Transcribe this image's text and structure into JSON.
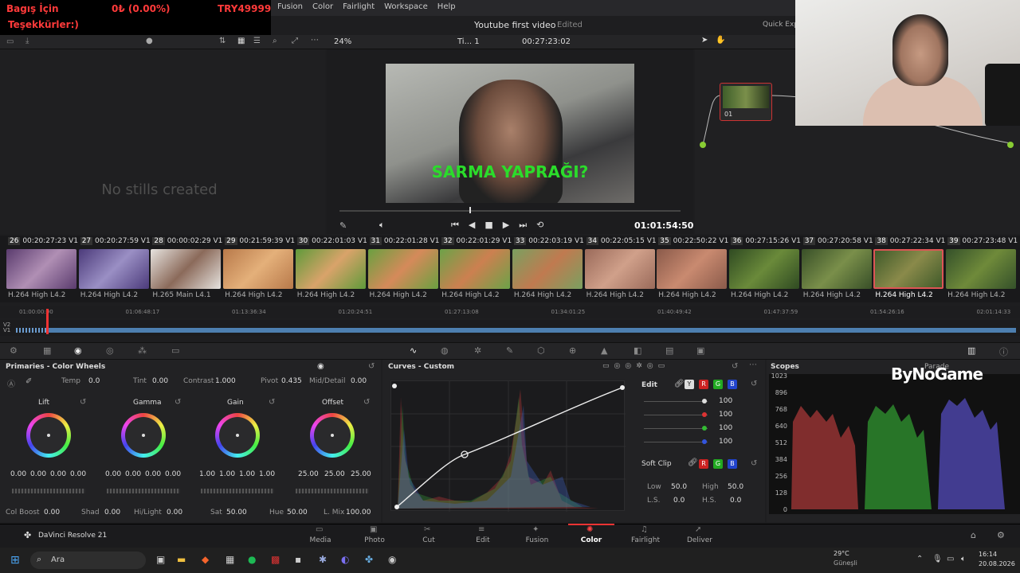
{
  "menu": [
    "Fusion",
    "Color",
    "Fairlight",
    "Workspace",
    "Help"
  ],
  "donation": {
    "line1": "Bagış İçin",
    "amount": "0₺ (0.00%)",
    "goal": "TRY49999",
    "line2": "Teşekkürler:)"
  },
  "project": {
    "title": "Youtube first video",
    "status": "Edited",
    "quick_export": "Quick Export"
  },
  "toolbar": {
    "zoom": "24%",
    "timeline": "Ti... 1",
    "timecode": "00:27:23:02"
  },
  "gallery": {
    "empty": "No stills created"
  },
  "viewer": {
    "subtitle": "SARMA YAPRAĞI?",
    "time": "01:01:54:50"
  },
  "node": {
    "label": "01"
  },
  "clips": [
    {
      "num": "26",
      "tc": "00:20:27:23",
      "track": "V1",
      "codec": "H.264 High L4.2",
      "c1": "#5a3b6e",
      "c2": "#b08fb4"
    },
    {
      "num": "27",
      "tc": "00:20:27:59",
      "track": "V1",
      "codec": "H.264 High L4.2",
      "c1": "#4b3a7a",
      "c2": "#9a8fc4"
    },
    {
      "num": "28",
      "tc": "00:00:02:29",
      "track": "V1",
      "codec": "H.265 Main L4.1",
      "c1": "#e6e3df",
      "c2": "#8b6a5a"
    },
    {
      "num": "29",
      "tc": "00:21:59:39",
      "track": "V1",
      "codec": "H.264 High L4.2",
      "c1": "#b8794a",
      "c2": "#e4b07a"
    },
    {
      "num": "30",
      "tc": "00:22:01:03",
      "track": "V1",
      "codec": "H.264 High L4.2",
      "c1": "#5f9a3a",
      "c2": "#d9a36a"
    },
    {
      "num": "31",
      "tc": "00:22:01:28",
      "track": "V1",
      "codec": "H.264 High L4.2",
      "c1": "#6aa040",
      "c2": "#d58a5a"
    },
    {
      "num": "32",
      "tc": "00:22:01:29",
      "track": "V1",
      "codec": "H.264 High L4.2",
      "c1": "#6ca248",
      "c2": "#cc8050"
    },
    {
      "num": "33",
      "tc": "00:22:03:19",
      "track": "V1",
      "codec": "H.264 High L4.2",
      "c1": "#7aa060",
      "c2": "#c07a50"
    },
    {
      "num": "34",
      "tc": "00:22:05:15",
      "track": "V1",
      "codec": "H.264 High L4.2",
      "c1": "#9a6a5a",
      "c2": "#d0a08a"
    },
    {
      "num": "35",
      "tc": "00:22:50:22",
      "track": "V1",
      "codec": "H.264 High L4.2",
      "c1": "#8a5a4a",
      "c2": "#c98a70"
    },
    {
      "num": "36",
      "tc": "00:27:15:26",
      "track": "V1",
      "codec": "H.264 High L4.2",
      "c1": "#2f4a22",
      "c2": "#6a8a3a"
    },
    {
      "num": "37",
      "tc": "00:27:20:58",
      "track": "V1",
      "codec": "H.264 High L4.2",
      "c1": "#384f28",
      "c2": "#7a8f4a"
    },
    {
      "num": "38",
      "tc": "00:27:22:34",
      "track": "V1",
      "codec": "H.264 High L4.2",
      "c1": "#3f5a2a",
      "c2": "#8a8a4a"
    },
    {
      "num": "39",
      "tc": "00:27:23:48",
      "track": "V1",
      "codec": "H.264 High L4.2",
      "c1": "#34502a",
      "c2": "#6f8a3a"
    }
  ],
  "ruler": [
    "01:00:00:00",
    "01:06:48:17",
    "01:13:36:34",
    "01:20:24:51",
    "01:27:13:08",
    "01:34:01:25",
    "01:40:49:42",
    "01:47:37:59",
    "01:54:26:16",
    "02:01:14:33"
  ],
  "tracks": {
    "v2": "V2",
    "v1": "V1"
  },
  "primaries": {
    "title": "Primaries - Color Wheels",
    "temp_label": "Temp",
    "temp": "0.0",
    "tint_label": "Tint",
    "tint": "0.00",
    "contrast_label": "Contrast",
    "contrast": "1.000",
    "pivot_label": "Pivot",
    "pivot": "0.435",
    "middetail_label": "Mid/Detail",
    "middetail": "0.00",
    "wheels": [
      {
        "name": "Lift",
        "vals": [
          "0.00",
          "0.00",
          "0.00",
          "0.00"
        ]
      },
      {
        "name": "Gamma",
        "vals": [
          "0.00",
          "0.00",
          "0.00",
          "0.00"
        ]
      },
      {
        "name": "Gain",
        "vals": [
          "1.00",
          "1.00",
          "1.00",
          "1.00"
        ]
      },
      {
        "name": "Offset",
        "vals": [
          "25.00",
          "25.00",
          "25.00"
        ]
      }
    ],
    "colboost_label": "Col Boost",
    "colboost": "0.00",
    "shad_label": "Shad",
    "shad": "0.00",
    "hilight_label": "Hi/Light",
    "hilight": "0.00",
    "sat_label": "Sat",
    "sat": "50.00",
    "hue_label": "Hue",
    "hue": "50.00",
    "lmix_label": "L. Mix",
    "lmix": "100.00"
  },
  "curves": {
    "title": "Curves - Custom",
    "edit": "Edit",
    "channels": [
      "Y",
      "R",
      "G",
      "B"
    ],
    "values": [
      "100",
      "100",
      "100",
      "100"
    ],
    "softclip": "Soft Clip",
    "low_label": "Low",
    "low": "50.0",
    "high_label": "High",
    "high": "50.0",
    "ls_label": "L.S.",
    "ls": "0.0",
    "hs_label": "H.S.",
    "hs": "0.0"
  },
  "scopes": {
    "title": "Scopes",
    "mode": "Parade",
    "logo": "ByNoGame",
    "labels": [
      "1023",
      "896",
      "768",
      "640",
      "512",
      "384",
      "256",
      "128",
      "0"
    ]
  },
  "pages": [
    "Media",
    "Photo",
    "Cut",
    "Edit",
    "Fusion",
    "Color",
    "Fairlight",
    "Deliver"
  ],
  "app": {
    "name": "DaVinci Resolve 21"
  },
  "taskbar": {
    "search": "Ara",
    "weather_temp": "29°C",
    "weather_desc": "Güneşli",
    "time": "16:14",
    "date": "20.08.2026"
  }
}
